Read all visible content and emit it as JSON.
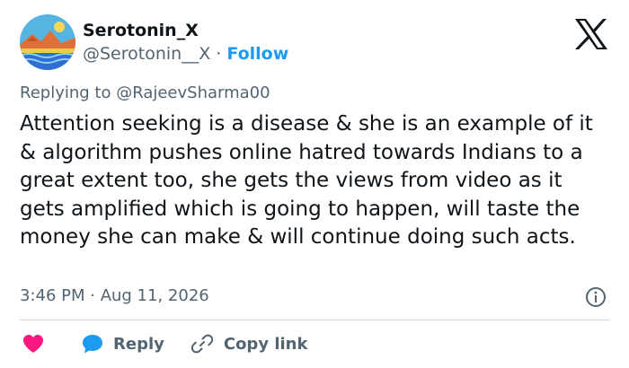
{
  "tweet": {
    "author": {
      "display_name": "Serotonin_X",
      "handle": "@Serotonin__X",
      "separator": "·",
      "follow_label": "Follow"
    },
    "reply_prefix": "Replying to",
    "reply_to": "@RajeevSharma00",
    "body": "Attention seeking is a disease & she is an example of it & algorithm pushes online hatred towards Indians to a great extent too, she gets the views from video as it gets amplified which is going to happen, will taste the money she can make & will continue doing such acts.",
    "timestamp": "3:46 PM · Aug 11, 2026"
  },
  "actions": {
    "reply_label": "Reply",
    "copy_link_label": "Copy link"
  },
  "colors": {
    "accent": "#1d9bf0",
    "heart": "#f91880",
    "text": "#0f1419",
    "secondary": "#536471"
  },
  "icons": [
    "avatar-image",
    "x-logo-icon",
    "info-icon",
    "heart-icon",
    "reply-bubble-icon",
    "link-icon"
  ]
}
